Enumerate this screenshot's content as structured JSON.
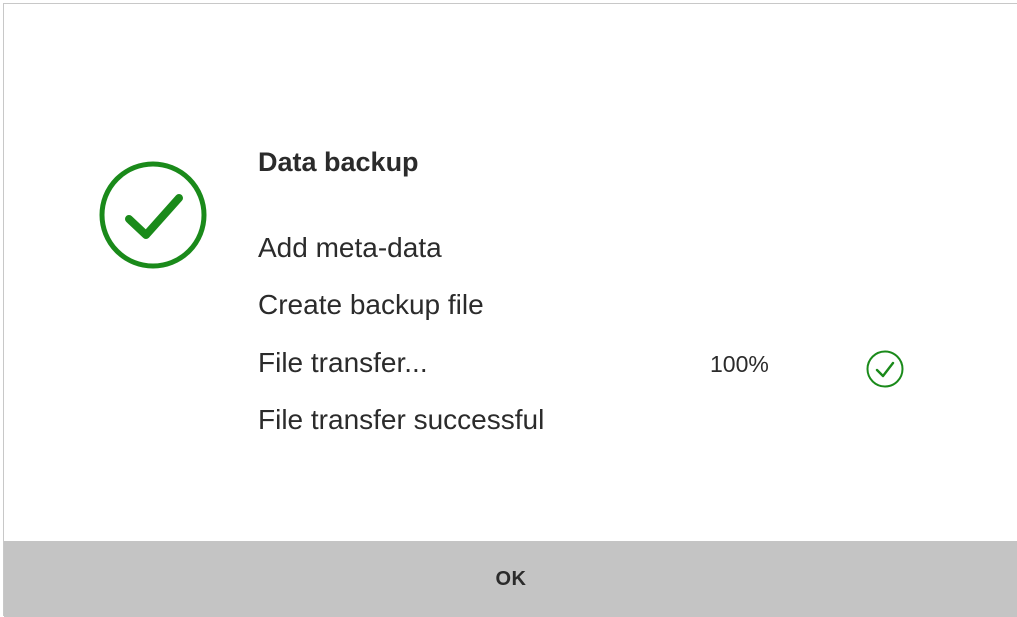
{
  "dialog": {
    "title": "Data backup",
    "status_icon": "check-circle-icon",
    "accent_color": "#1a8a1a",
    "steps": [
      {
        "label": "Add meta-data"
      },
      {
        "label": "Create backup file"
      },
      {
        "label": "File transfer...",
        "progress": "100%",
        "progress_value": 100,
        "status_icon": "check-circle-icon"
      },
      {
        "label": "File transfer successful"
      }
    ],
    "ok_label": "OK",
    "button_bg": "#c4c4c4"
  }
}
